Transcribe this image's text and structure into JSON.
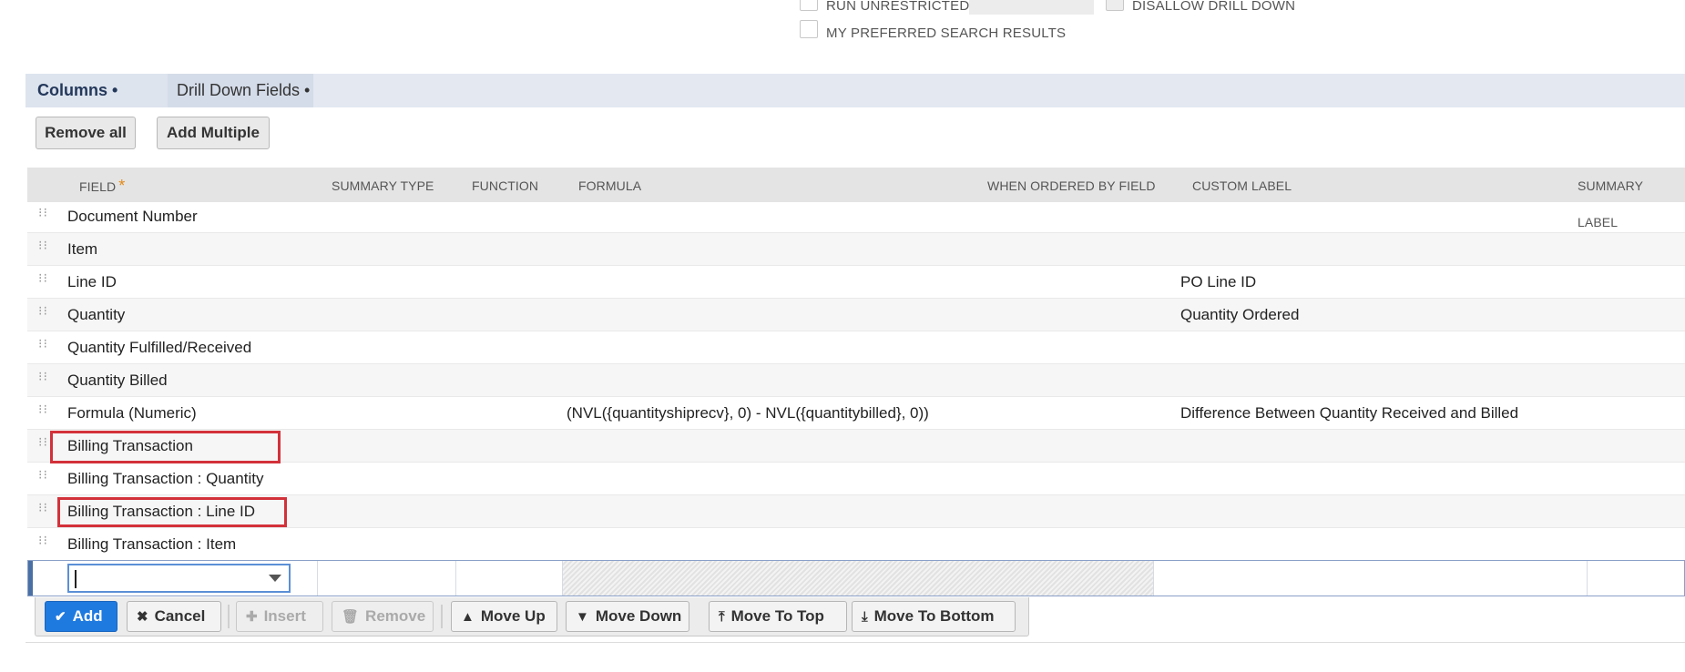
{
  "options": {
    "run_unrestricted": "RUN UNRESTRICTED",
    "disallow_drill_down": "DISALLOW DRILL DOWN",
    "my_preferred_search_results": "MY PREFERRED SEARCH RESULTS"
  },
  "tabs": [
    {
      "label": "Columns •"
    },
    {
      "label": "Drill Down Fields •"
    }
  ],
  "actions": {
    "remove_all": "Remove all",
    "add_multiple": "Add Multiple"
  },
  "columns": {
    "field": "FIELD",
    "required_mark": "*",
    "summary_type": "SUMMARY TYPE",
    "function": "FUNCTION",
    "formula": "FORMULA",
    "when_ordered_by_field": "WHEN ORDERED BY FIELD",
    "custom_label": "CUSTOM LABEL",
    "summary_label": "SUMMARY LABEL"
  },
  "rows": [
    {
      "field": "Document Number",
      "formula": "",
      "custom_label": ""
    },
    {
      "field": "Item",
      "formula": "",
      "custom_label": ""
    },
    {
      "field": "Line ID",
      "formula": "",
      "custom_label": "PO Line ID"
    },
    {
      "field": "Quantity",
      "formula": "",
      "custom_label": "Quantity Ordered"
    },
    {
      "field": "Quantity Fulfilled/Received",
      "formula": "",
      "custom_label": ""
    },
    {
      "field": "Quantity Billed",
      "formula": "",
      "custom_label": ""
    },
    {
      "field": "Formula (Numeric)",
      "formula": "(NVL({quantityshiprecv}, 0) - NVL({quantitybilled}, 0))",
      "custom_label": "Difference Between Quantity Received and Billed"
    },
    {
      "field": "Billing Transaction",
      "formula": "",
      "custom_label": ""
    },
    {
      "field": "Billing Transaction : Quantity",
      "formula": "",
      "custom_label": ""
    },
    {
      "field": "Billing Transaction : Line ID",
      "formula": "",
      "custom_label": ""
    },
    {
      "field": "Billing Transaction : Item",
      "formula": "",
      "custom_label": ""
    }
  ],
  "toolbar": {
    "add": "Add",
    "cancel": "Cancel",
    "insert": "Insert",
    "remove": "Remove",
    "move_up": "Move Up",
    "move_down": "Move Down",
    "move_to_top": "Move To Top",
    "move_to_bottom": "Move To Bottom"
  },
  "icons": {
    "add": "checkmark-icon",
    "cancel": "x-icon",
    "insert": "plus-icon",
    "remove": "trash-icon",
    "move_up": "arrow-up-icon",
    "move_down": "arrow-down-icon",
    "move_to_top": "arrow-to-top-icon",
    "move_to_bottom": "arrow-to-bottom-icon"
  },
  "colors": {
    "primary": "#1f7ae0",
    "highlight": "#d3313a",
    "tab_bg": "#e3e8f1",
    "required": "#e38a1a"
  }
}
